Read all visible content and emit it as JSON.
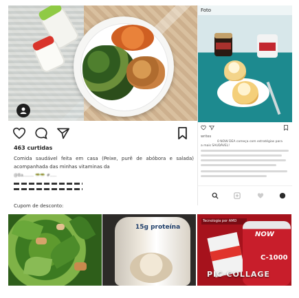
{
  "post": {
    "likes": "463 curtidas",
    "caption": "Comida saudável feita em casa (Peixe, purê de abóbora e salada) acompanhada das minhas vitaminas da",
    "caption_more": "@Ba........ 🥗🥗 #.....",
    "coupon": "Cupom de desconto:"
  },
  "right_post": {
    "label": "Foto",
    "comments": [
      "writes",
      "0 NOW DEA começa com estratégias para",
      "a mais SAUDÁVEL!"
    ]
  },
  "protein": {
    "text": "15g proteína"
  },
  "now": {
    "badge": "Tecnologia por AMD",
    "brand": "NOW",
    "product": "C-1000"
  },
  "watermark": "PIC·COLLAGE",
  "icons": {
    "like": "heart-icon",
    "comment": "comment-icon",
    "share": "share-icon",
    "save": "bookmark-icon",
    "profile": "profile-icon"
  },
  "colors": {
    "text": "#222222",
    "now_red": "#c81e2b"
  }
}
